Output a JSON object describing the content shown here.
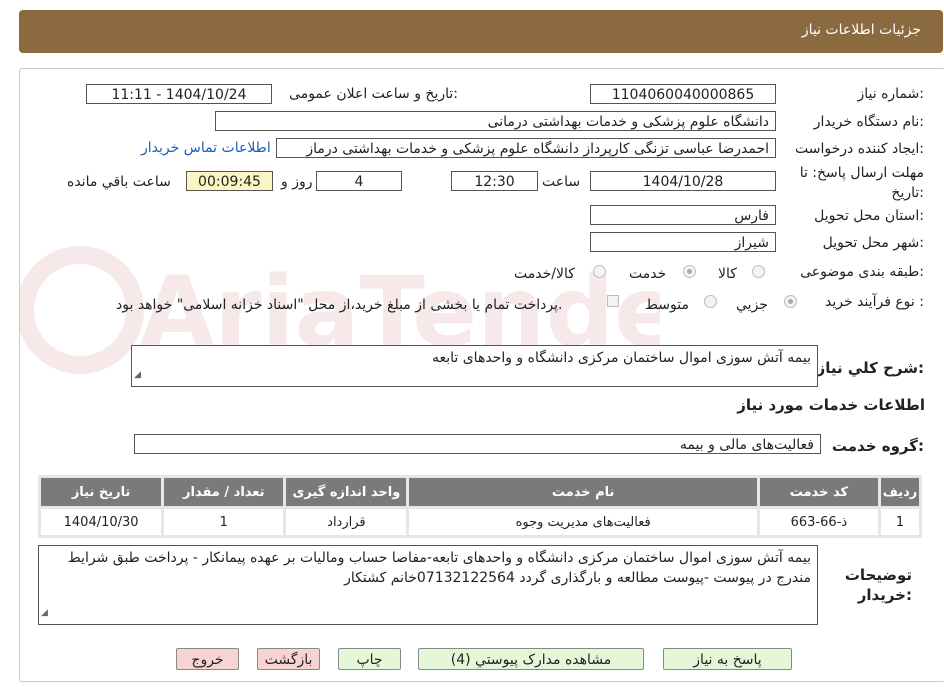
{
  "header": {
    "title": "جزئیات اطلاعات نیاز"
  },
  "form": {
    "need_number": {
      "label": "شماره نیاز:",
      "value": "1104060040000865"
    },
    "announce_datetime": {
      "label": "تاریخ و ساعت اعلان عمومی:",
      "value": "1404/10/24 - 11:11"
    },
    "buyer_org": {
      "label": "نام دستگاه خریدار:",
      "value": "دانشگاه علوم پزشکی و خدمات بهداشتی درمانی"
    },
    "requester": {
      "label": "ایجاد کننده درخواست:",
      "value": "احمدرضا عباسی تزنگی کارپرداز دانشگاه علوم پزشکی و خدمات بهداشتی درماز",
      "contact_link": "اطلاعات تماس خریدار"
    },
    "deadline": {
      "label_line1": "مهلت ارسال پاسخ: تا",
      "label_line2": "تاریخ:",
      "date": "1404/10/28",
      "time_label": "ساعت",
      "time": "12:30",
      "days": "4",
      "days_label": "روز و",
      "remaining": "00:09:45",
      "remaining_label": "ساعت باقي مانده"
    },
    "province": {
      "label": "استان محل تحویل:",
      "value": "فارس"
    },
    "city": {
      "label": "شهر محل تحویل:",
      "value": "شیراز"
    },
    "category": {
      "label": "طبقه بندی موضوعی:",
      "options": [
        "کالا",
        "خدمت",
        "کالا/خدمت"
      ],
      "selected": "خدمت"
    },
    "process": {
      "label": "نوع فرآیند خرید :",
      "options": [
        "جزيي",
        "متوسط"
      ],
      "selected": "جزيي",
      "payment_note": "پرداخت تمام یا بخشی از مبلغ خرید،از محل \"اسناد خزانه اسلامی\" خواهد بود."
    },
    "summary": {
      "label": "شرح کلي نياز:",
      "value": "بیمه آتش سوزی اموال ساختمان مرکزی دانشگاه و واحدهای تابعه"
    },
    "services_title": "اطلاعات خدمات مورد نیاز",
    "service_group": {
      "label": "گروه خدمت:",
      "value": "فعالیت‌های مالی و بیمه"
    }
  },
  "table": {
    "headers": [
      "ردیف",
      "کد خدمت",
      "نام خدمت",
      "واحد اندازه گیری",
      "تعداد / مقدار",
      "تاریخ نیاز"
    ],
    "rows": [
      [
        "1",
        "ذ-66-663",
        "فعالیت‌های مدیریت وجوه",
        "قرارداد",
        "1",
        "1404/10/30"
      ]
    ]
  },
  "buyer_notes": {
    "label_line1": "توضیحات",
    "label_line2": "خریدار:",
    "value": "بیمه آتش سوزی اموال ساختمان مرکزی دانشگاه و واحدهای تابعه-مفاصا حساب وماليات بر عهده پیمانکار - پرداخت طبق شرایط مندرج در پیوست   -پیوست مطالعه و بارگذاری گردد  07132122564خانم کشتکار"
  },
  "buttons": {
    "reply": "پاسخ به نیاز",
    "attachments": "مشاهده مدارک پیوستي (4)",
    "print": "چاپ",
    "back": "بازگشت",
    "exit": "خروج"
  },
  "watermark": {
    "text": "AriaTender.neT"
  },
  "colors": {
    "titlebar": "#8c6a3f",
    "green_button": "#e5f7d9",
    "red_button": "#f8d3d3",
    "link": "#1a5fb4",
    "remaining_bg": "#fbf5c4",
    "table_header": "#7a7a7a"
  }
}
